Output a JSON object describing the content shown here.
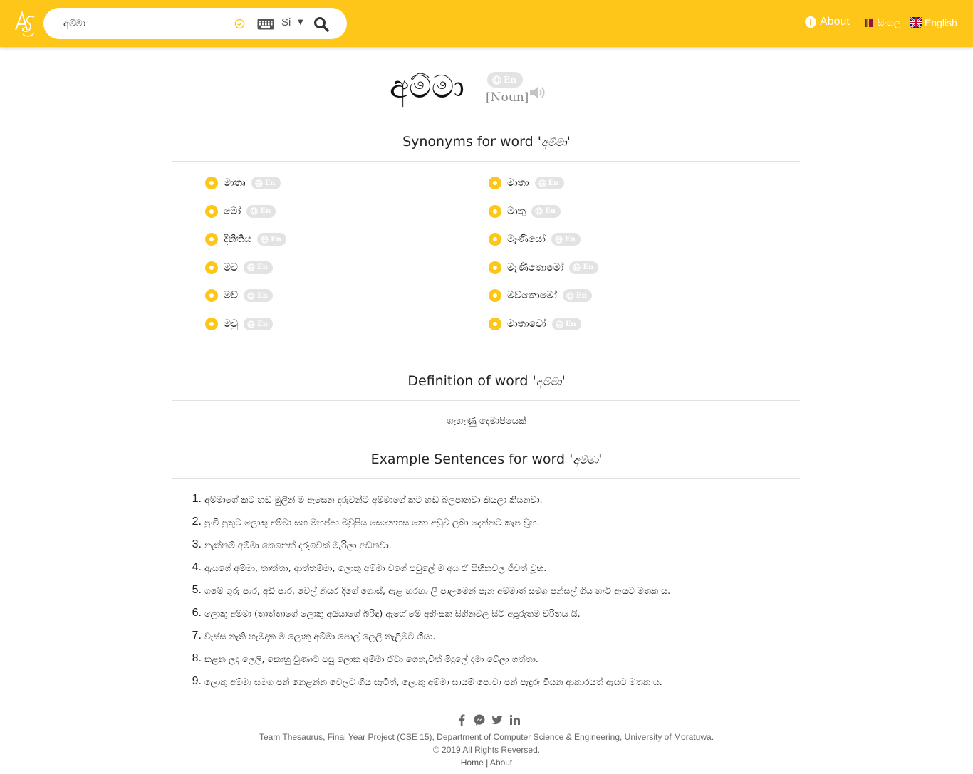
{
  "header": {
    "search_value": "අම්මා",
    "language_select": "Si",
    "nav_about": "About",
    "nav_sinhala": "සිංහල",
    "nav_english": "English"
  },
  "word": {
    "headword": "අම්මා",
    "translate_pill": "En",
    "part_of_speech": "[Noun]"
  },
  "synonyms": {
    "title_prefix": "Synonyms for word '",
    "title_word": "අම්මා",
    "title_suffix": "'",
    "pill_label": "En",
    "left": [
      "මාතෘ",
      "මෝ",
      "දිනිතිය",
      "මව",
      "මව්",
      "මවු"
    ],
    "right": [
      "මාතා",
      "මාතු",
      "මෑණියෝ",
      "මෑණිතොමෝ",
      "මව්තොමෝ",
      "මාතාවෝ"
    ]
  },
  "definition": {
    "title_prefix": "Definition of word '",
    "title_word": "අම්මා",
    "title_suffix": "'",
    "text": "ගැහැණු දෙමාපියෙක්"
  },
  "examples": {
    "title_prefix": "Example Sentences for word '",
    "title_word": "අම්මා",
    "title_suffix": "'",
    "items": [
      {
        "num": "1.",
        "text": "අම්මාගේ කට හඬ මුලින් ම ඇසෙන දරුවන්ට අම්මාගේ කට හඬ බලපානවා කියලා කියනවා."
      },
      {
        "num": "2.",
        "text": "පුංචි පුතුට ලොකු අම්මා සහ මහප්පා මවුපිය සෙනෙහස නො අඩුව ලබා දෙන්නට කැප වූහ."
      },
      {
        "num": "3.",
        "text": "නැත්නම් අම්මා කෙනෙක් දරුවෙක් මැරිලා අඬනවා."
      },
      {
        "num": "4.",
        "text": "ඇයගේ අම්මා, තාත්තා, ආත්තම්මා, ලොකු අම්මා වගේ පවුලේ ම අය ඒ සිහිනවල ජීවත් වූහ."
      },
      {
        "num": "5.",
        "text": "ගමේ ගුරු පාර, අඩි පාර, වෙල් නියර දිගේ ගොස්, ඇළ හරහා ලී පාලමෙන් පැන අම්මාත් සමග පන්සල් ගිය හැටි ඇයට මතක ය."
      },
      {
        "num": "6.",
        "text": "ලොකු අම්මා (තාත්තාගේ ලොකු අයියාගේ බිරිඳ) ඇගේ මේ අභිංසක සිහිනවල සිටි අපූරුතම චරිතය යි."
      },
      {
        "num": "7.",
        "text": "වැස්ස නැති හැමදාක ම ලොකු අම්මා පොල් ලෙලි තැළීමට ගියා."
      },
      {
        "num": "8.",
        "text": "කළන ලද ලෙලි, කොහු වුණාට පසු ලොකු අම්මා ඒවා ගෙනැවිත් මිදුලේ දමා වේලා ගත්තා."
      },
      {
        "num": "9.",
        "text": "ලොකු අම්මා සමග පන් නෙළන්න වෙලට ගිය සැටිත්, ලොකු අම්මා සායම් පොවා පන් පැදුරු වියන ආකාරයත් ඇයට මතක ය."
      }
    ]
  },
  "footer": {
    "credit": "Team Thesaurus, Final Year Project (CSE 15), Department of Computer Science & Engineering, University of Moratuwa.",
    "rights": "© 2019 All Rights Reversed.",
    "link_home": "Home",
    "separator": "|",
    "link_about": "About"
  },
  "colors": {
    "accent": "#ffc61a",
    "pill": "#e3e3e3"
  },
  "icons": [
    "logo-icon",
    "check-icon",
    "keyboard-icon",
    "search-icon",
    "info-icon",
    "sri-lanka-flag-icon",
    "uk-flag-icon",
    "globe-icon",
    "speaker-icon",
    "facebook-icon",
    "messenger-icon",
    "twitter-icon",
    "linkedin-icon"
  ]
}
